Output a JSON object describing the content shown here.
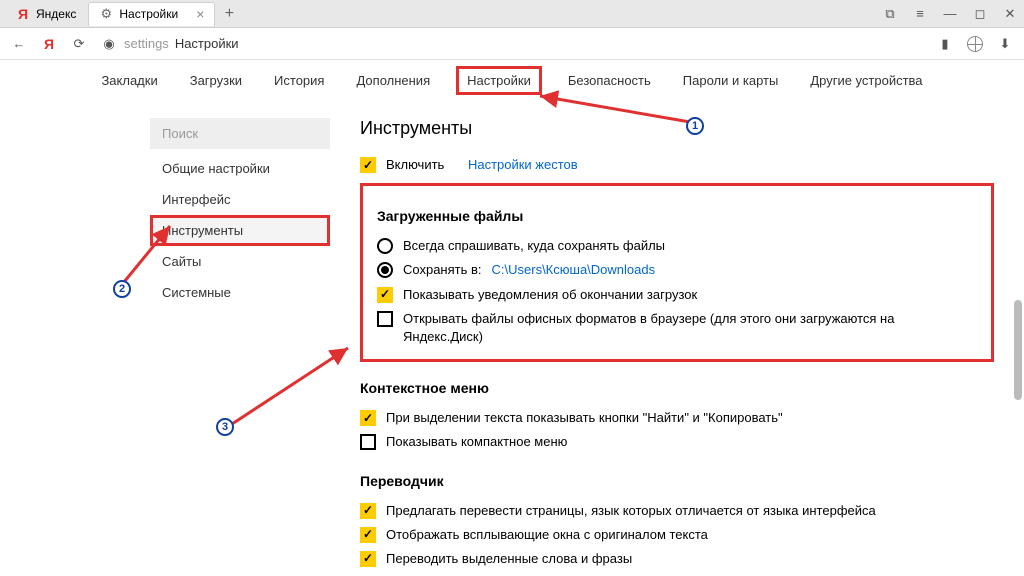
{
  "titlebar": {
    "tab1": {
      "label": "Яндекс"
    },
    "tab2": {
      "label": "Настройки"
    }
  },
  "address": {
    "prefix": "settings",
    "page": "Настройки"
  },
  "topnav": {
    "items": [
      "Закладки",
      "Загрузки",
      "История",
      "Дополнения",
      "Настройки",
      "Безопасность",
      "Пароли и карты",
      "Другие устройства"
    ]
  },
  "sidebar": {
    "search": "Поиск",
    "items": [
      "Общие настройки",
      "Интерфейс",
      "Инструменты",
      "Сайты",
      "Системные"
    ]
  },
  "content": {
    "tools_title": "Инструменты",
    "enable": "Включить",
    "gesture_link": "Настройки жестов",
    "downloads": {
      "title": "Загруженные файлы",
      "ask": "Всегда спрашивать, куда сохранять файлы",
      "save_to_label": "Сохранять в:",
      "save_to_path": "C:\\Users\\Ксюша\\Downloads",
      "notify": "Показывать уведомления об окончании загрузок",
      "office": "Открывать файлы офисных форматов в браузере (для этого они загружаются на Яндекс.Диск)"
    },
    "context": {
      "title": "Контекстное меню",
      "find_copy": "При выделении текста показывать кнопки \"Найти\" и \"Копировать\"",
      "compact": "Показывать компактное меню"
    },
    "translator": {
      "title": "Переводчик",
      "offer": "Предлагать перевести страницы, язык которых отличается от языка интерфейса",
      "popup": "Отображать всплывающие окна с оригиналом текста",
      "selection": "Переводить выделенные слова и фразы"
    }
  },
  "markers": {
    "m1": "1",
    "m2": "2",
    "m3": "3"
  }
}
